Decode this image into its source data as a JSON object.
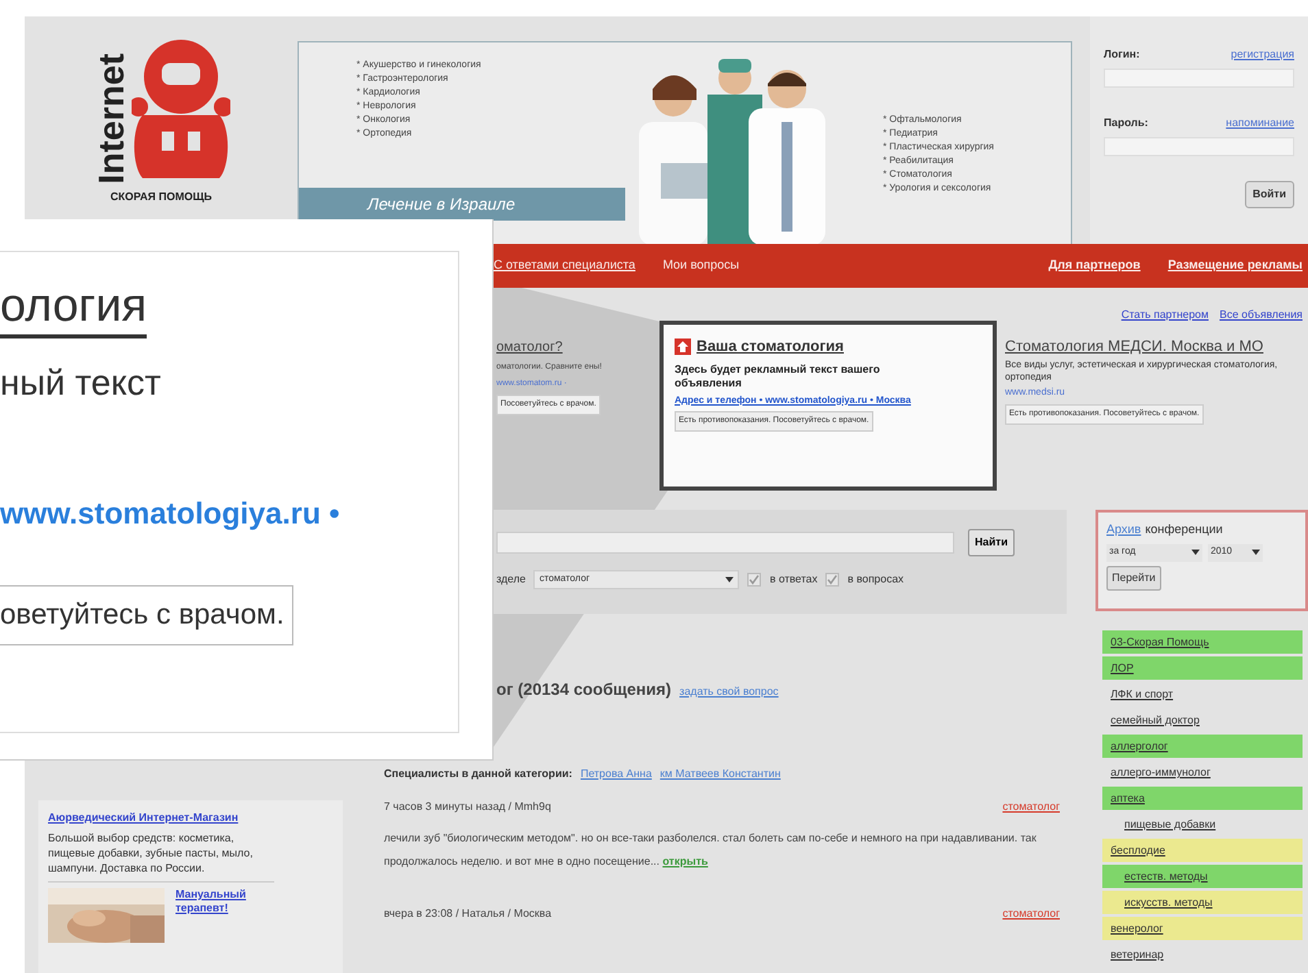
{
  "logo": {
    "vertical_text": "Internet",
    "caption": "СКОРАЯ ПОМОЩЬ"
  },
  "banner": {
    "left_items": [
      "* Акушерство и гинекология",
      "* Гастроэнтерология",
      "* Кардиология",
      "* Неврология",
      "* Онкология",
      "* Ортопедия"
    ],
    "right_items": [
      "* Офтальмология",
      "* Педиатрия",
      "* Пластическая хирургия",
      "* Реабилитация",
      "* Стоматология",
      "* Урология и сексология"
    ],
    "caption": "Лечение в Израиле"
  },
  "login": {
    "login_label": "Логин:",
    "register_link": "регистрация",
    "password_label": "Пароль:",
    "remind_link": "напоминание",
    "submit": "Войти"
  },
  "nav": {
    "left": [
      "С ответами специалиста",
      "Мои вопросы"
    ],
    "right": [
      "Для партнеров",
      "Размещение рекламы"
    ]
  },
  "partner_links": [
    "Стать партнером",
    "Все объявления"
  ],
  "ads": [
    {
      "kind": "partial",
      "title": "оматолог?",
      "text": "оматологии. Сравните ены!",
      "url": "www.stomatom.ru ·",
      "warning": "Посоветуйтесь с врачом."
    },
    {
      "kind": "highlighted",
      "title": "Ваша стоматология",
      "text": "Здесь будет рекламный текст вашего объявления",
      "url": "Адрес и телефон • www.stomatologiya.ru • Москва",
      "warning": "Есть противопоказания. Посоветуйтесь с врачом."
    },
    {
      "kind": "plain",
      "title": "Стоматология МЕДСИ. Москва и МО",
      "text": "Все виды услуг, эстетическая и хирургическая стоматология, ортопедия",
      "url": "www.medsi.ru",
      "warning": "Есть противопоказания. Посоветуйтесь с врачом."
    }
  ],
  "search": {
    "button": "Найти",
    "section_label": "зделе",
    "section_value": "стоматолог",
    "options": [
      {
        "label": "в ответах",
        "checked": true
      },
      {
        "label": "в вопросах",
        "checked": true
      }
    ]
  },
  "archive": {
    "link": "Архив",
    "label": "конференции",
    "period": "за год",
    "year": "2010",
    "button": "Перейти"
  },
  "topic": {
    "title": "ог (20134 сообщения)",
    "ask_link": "задать свой вопрос",
    "specialists_label": "Специалисты в данной категории:",
    "specialists": [
      "Петрова Анна",
      "км Матвеев Константин"
    ]
  },
  "posts": [
    {
      "meta": "7 часов 3 минуты назад / Mmh9q",
      "tag": "стоматолог",
      "text": "лечили зуб \"биологическим методом\". но он все-таки разболелся. стал болеть сам по-себе и немного на при надавливании. так продолжалось неделю. и вот мне в одно посещение...",
      "open_link": "открыть"
    },
    {
      "meta": "вчера в 23:08 / Наталья / Москва",
      "tag": "стоматолог"
    }
  ],
  "sidebar_ads": [
    {
      "kind": "text",
      "title": "Аюрведический Интернет-Магазин",
      "text": "Большой выбор средств: косметика, пищевые добавки, зубные пасты, мыло, шампуни. Доставка по России."
    },
    {
      "kind": "picture",
      "title": "Мануальный терапевт!"
    }
  ],
  "categories": [
    {
      "label": "03-Скорая Помощь",
      "color": "#7fd66a"
    },
    {
      "label": "ЛОР",
      "color": "#7fd66a"
    },
    {
      "label": "ЛФК и спорт"
    },
    {
      "label": "семейный доктор"
    },
    {
      "label": "аллерголог",
      "color": "#7fd66a"
    },
    {
      "label": "аллерго-иммунолог"
    },
    {
      "label": "аптека",
      "color": "#7fd66a",
      "children": [
        {
          "label": "пищевые добавки"
        }
      ]
    },
    {
      "label": "бесплодие",
      "color": "#ebe98f",
      "children": [
        {
          "label": "естеств. методы",
          "color": "#7fd66a"
        },
        {
          "label": "искусств. методы",
          "color": "#ebe98f"
        }
      ]
    },
    {
      "label": "венеролог",
      "color": "#ebe98f"
    },
    {
      "label": "ветеринар"
    }
  ],
  "callout": {
    "title": "ология",
    "text": "ный текст",
    "url": "www.stomatologiya.ru •",
    "warning": "оветуйтесь с врачом."
  }
}
